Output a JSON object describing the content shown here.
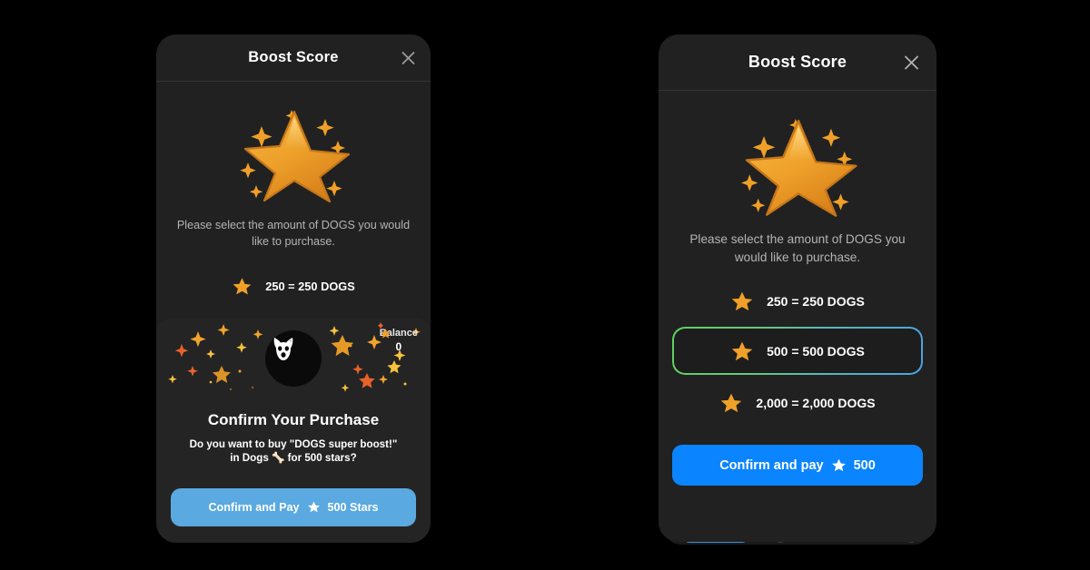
{
  "left_panel": {
    "header": {
      "title": "Boost Score",
      "close_icon": "close-icon"
    },
    "hero_icon": "star-illustration",
    "description": "Please select the amount of DOGS you would like to purchase.",
    "options": [
      {
        "icon": "star-icon",
        "label": "250 = 250 DOGS",
        "selected": false
      }
    ],
    "purchase_sheet": {
      "avatar_icon": "dogs-logo-icon",
      "balance_label": "Balance",
      "balance_star_icon": "star-icon",
      "balance_value": "0",
      "title": "Confirm Your Purchase",
      "subtitle_line1": "Do you want to buy \"DOGS super boost!\"",
      "subtitle_line2": "in Dogs 🦴 for 500 stars?",
      "confirm_button": {
        "prefix": "Confirm and Pay",
        "star_icon": "star-icon",
        "amount": "500 Stars",
        "color": "#5aa9e0"
      }
    }
  },
  "right_panel": {
    "header": {
      "title": "Boost Score",
      "close_icon": "close-icon"
    },
    "hero_icon": "star-illustration",
    "description": "Please select the amount of DOGS you would like to purchase.",
    "options": [
      {
        "icon": "star-icon",
        "label": "250 = 250 DOGS",
        "selected": false
      },
      {
        "icon": "star-icon",
        "label": "500 = 500 DOGS",
        "selected": true
      },
      {
        "icon": "star-icon",
        "label": "2,000 = 2,000 DOGS",
        "selected": false
      }
    ],
    "confirm_button": {
      "prefix": "Confirm and pay",
      "star_icon": "star-icon",
      "amount": "500",
      "color": "#0a84ff"
    },
    "selection_border": {
      "from": "#5fd15f",
      "to": "#4aa3e2"
    }
  },
  "theme": {
    "page_background": "#000000",
    "card_background": "#212121",
    "sheet_background": "#242424",
    "star_color": "#f0a028",
    "text_primary": "#ffffff",
    "text_secondary": "#b4b4b4"
  }
}
